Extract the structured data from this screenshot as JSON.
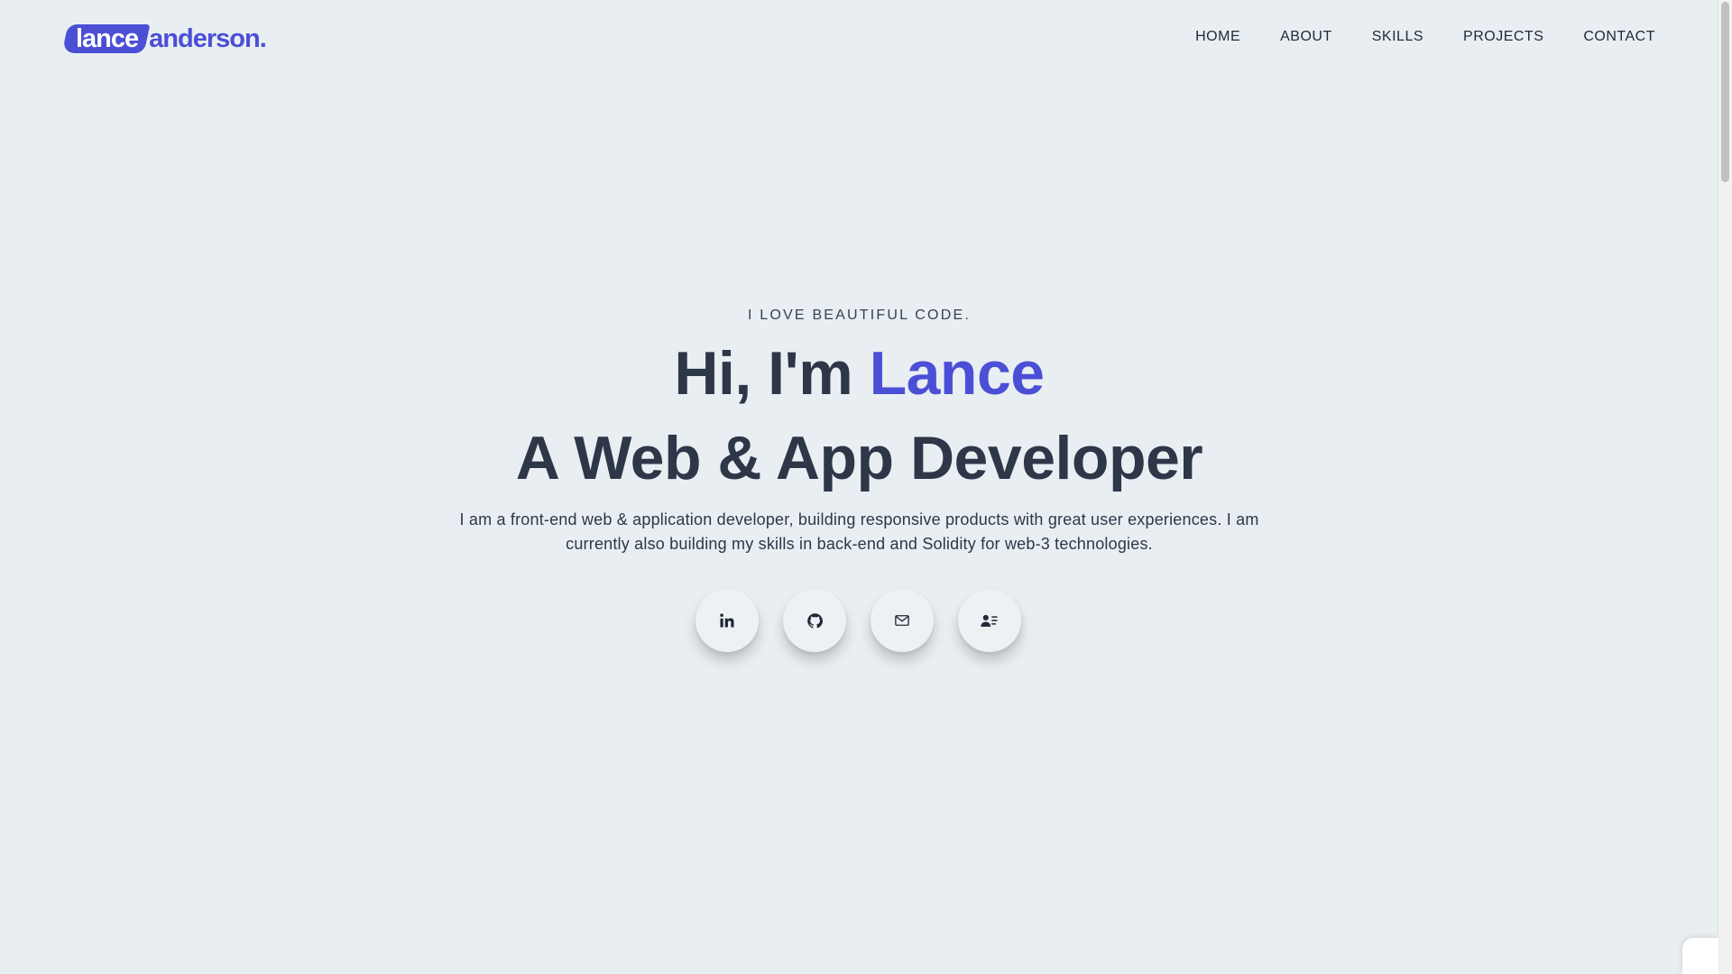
{
  "brand": {
    "logo_first": "lance",
    "logo_last": "anderson.",
    "accent_color": "#4b4fd6"
  },
  "nav": {
    "items": [
      {
        "label": "HOME"
      },
      {
        "label": "ABOUT"
      },
      {
        "label": "SKILLS"
      },
      {
        "label": "PROJECTS"
      },
      {
        "label": "CONTACT"
      }
    ]
  },
  "hero": {
    "eyebrow": "I LOVE BEAUTIFUL CODE.",
    "greeting": "Hi, I'm ",
    "name": "Lance",
    "role": "A Web & App Developer",
    "bio": "I am a front-end web & application developer, building responsive products with great user experiences. I am currently also building my skills in back-end and Solidity for web-3 technologies."
  },
  "socials": [
    {
      "icon": "linkedin-icon"
    },
    {
      "icon": "github-icon"
    },
    {
      "icon": "mail-icon"
    },
    {
      "icon": "resume-icon"
    }
  ]
}
